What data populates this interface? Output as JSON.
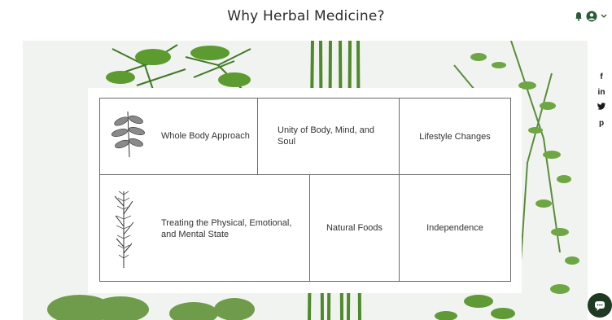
{
  "header": {
    "title": "Why Herbal Medicine?",
    "icons": [
      "bell-icon",
      "user-icon",
      "chevron-down-icon"
    ]
  },
  "social": {
    "links": [
      {
        "name": "facebook",
        "glyph": "f"
      },
      {
        "name": "linkedin",
        "glyph": "in"
      },
      {
        "name": "twitter",
        "glyph": "🐦"
      },
      {
        "name": "pinterest",
        "glyph": "p"
      }
    ]
  },
  "grid": {
    "row1": [
      "Whole Body Approach",
      "Unity of Body, Mind, and Soul",
      "Lifestyle Changes"
    ],
    "row2": [
      "Treating the Physical, Emotional, and Mental State",
      "Natural Foods",
      "Independence"
    ]
  },
  "colors": {
    "accent": "#1e3a23",
    "border": "#6b6b6b",
    "background": "#f1f3f0"
  }
}
